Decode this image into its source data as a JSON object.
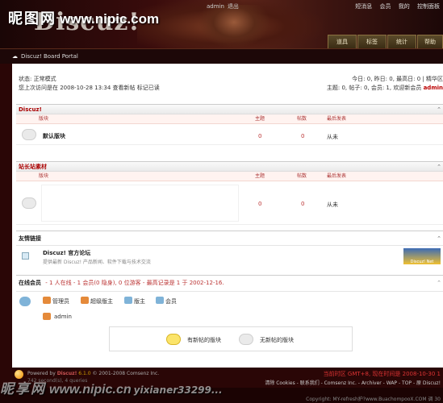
{
  "header": {
    "watermark_cn": "昵图网",
    "watermark_url": "www.nipic.com",
    "logo": "Discuz!",
    "user": "admin",
    "logout": "退出",
    "top_links": [
      "短消息",
      "会员",
      "我的",
      "控制面板"
    ],
    "tabs": [
      "道具",
      "标签",
      "统计",
      "帮助"
    ]
  },
  "nav": {
    "breadcrumb": "Discuz! Board Portal"
  },
  "status": {
    "line1": "状态: 正常模式",
    "line2_prefix": "您上次访问是在  2008-10-28 13:34",
    "new_posts": "查看新帖",
    "mark_read": "标记已读",
    "today_stats": "今日: 0, 昨日: 0, 最高日: 0 | 精华区",
    "totals_prefix": "主题: 0, 帖子: 0, 会员: 1, 欢迎新会员",
    "newest_member": "admin"
  },
  "columns": {
    "forum": "版块",
    "topics": "主题",
    "posts": "帖数",
    "last": "最后发表"
  },
  "sections": [
    {
      "title": "Discuz!",
      "forum": "默认版块",
      "topics": "0",
      "posts": "0",
      "last": "从未"
    },
    {
      "title": "站长站素材",
      "forum": "",
      "topics": "0",
      "posts": "0",
      "last": "从未"
    }
  ],
  "links": {
    "title": "友情链接",
    "name": "Discuz! 官方论坛",
    "desc": "提供最新 Discuz! 产品新闻、软件下载与技术交流",
    "badge": "Discuz! Net"
  },
  "online": {
    "title": "在线会员",
    "summary": "- 1 人在线  - 1 会员(0 隐身), 0 位游客  - 最高记录是  1  于  2002-12-16.",
    "roles": [
      "管理员",
      "超级版主",
      "版主",
      "会员"
    ],
    "user": "admin"
  },
  "legend": {
    "new": "有新帖的版块",
    "none": "无新帖的版块"
  },
  "footer": {
    "powered": "Powered by",
    "brand": "Discuz!",
    "version": "6.1.0",
    "copyright": "© 2001-2008 Comsenz Inc.",
    "processed": "742 second(s), 4 queries",
    "time": "当前时区  GMT+8, 现在时间是  2008-10-30 1",
    "links": "清除 Cookies - 联系我们 - Comsenz Inc. - Archiver - WAP - TOP - 原 Discuz!",
    "copyright2": "Copyright: MY-refresh护?www.BuachompooX.COM 调 30"
  },
  "watermark_bottom": {
    "cn": "昵享网",
    "url": "www.nipic.cn",
    "id": "yixianer33299..."
  }
}
